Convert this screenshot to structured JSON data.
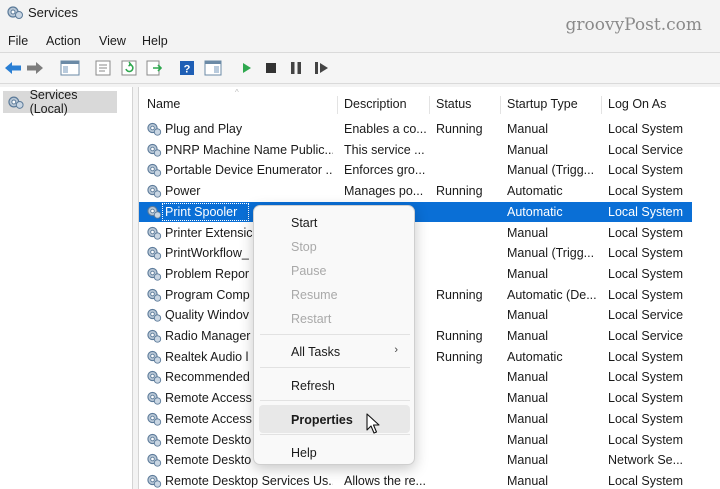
{
  "window": {
    "title": "Services",
    "watermark": "groovyPost.com"
  },
  "menu": [
    "File",
    "Action",
    "View",
    "Help"
  ],
  "toolbar": {
    "icons": [
      "back-arrow-icon",
      "forward-arrow-icon",
      "console-tree-icon",
      "properties-icon",
      "refresh-icon",
      "export-icon",
      "help-icon",
      "view-icon",
      "play-icon",
      "stop-icon",
      "pause-icon",
      "resume-icon"
    ]
  },
  "tree": {
    "label": "Services (Local)"
  },
  "columns": [
    "Name",
    "Description",
    "Status",
    "Startup Type",
    "Log On As"
  ],
  "rows": [
    {
      "name": "Plug and Play",
      "desc": "Enables a co...",
      "status": "Running",
      "startup": "Manual",
      "logon": "Local System"
    },
    {
      "name": "PNRP Machine Name Public...",
      "desc": "This service ...",
      "status": "",
      "startup": "Manual",
      "logon": "Local Service"
    },
    {
      "name": "Portable Device Enumerator ...",
      "desc": "Enforces gro...",
      "status": "",
      "startup": "Manual (Trigg...",
      "logon": "Local System"
    },
    {
      "name": "Power",
      "desc": "Manages po...",
      "status": "Running",
      "startup": "Automatic",
      "logon": "Local System"
    },
    {
      "name": "Print Spooler",
      "desc": "",
      "status": "",
      "startup": "Automatic",
      "logon": "Local System",
      "selected": true
    },
    {
      "name": "Printer Extensic",
      "desc": "",
      "status": "",
      "startup": "Manual",
      "logon": "Local System"
    },
    {
      "name": "PrintWorkflow_",
      "desc": "",
      "status": "",
      "startup": "Manual (Trigg...",
      "logon": "Local System"
    },
    {
      "name": "Problem Repor",
      "desc": "",
      "status": "",
      "startup": "Manual",
      "logon": "Local System"
    },
    {
      "name": "Program Comp",
      "desc": "",
      "status": "Running",
      "startup": "Automatic (De...",
      "logon": "Local System"
    },
    {
      "name": "Quality Windov",
      "desc": "",
      "status": "",
      "startup": "Manual",
      "logon": "Local Service"
    },
    {
      "name": "Radio Manager",
      "desc": "",
      "status": "Running",
      "startup": "Manual",
      "logon": "Local Service"
    },
    {
      "name": "Realtek Audio l",
      "desc": "",
      "status": "Running",
      "startup": "Automatic",
      "logon": "Local System"
    },
    {
      "name": "Recommended",
      "desc": "",
      "status": "",
      "startup": "Manual",
      "logon": "Local System"
    },
    {
      "name": "Remote Access",
      "desc": "",
      "status": "",
      "startup": "Manual",
      "logon": "Local System"
    },
    {
      "name": "Remote Access",
      "desc": "",
      "status": "",
      "startup": "Manual",
      "logon": "Local System"
    },
    {
      "name": "Remote Deskto",
      "desc": "",
      "status": "",
      "startup": "Manual",
      "logon": "Local System"
    },
    {
      "name": "Remote Deskto",
      "desc": "",
      "status": "",
      "startup": "Manual",
      "logon": "Network Se..."
    },
    {
      "name": "Remote Desktop Services Us...",
      "desc": "Allows the re...",
      "status": "",
      "startup": "Manual",
      "logon": "Local System"
    }
  ],
  "context_menu": {
    "start": "Start",
    "stop": "Stop",
    "pause": "Pause",
    "resume": "Resume",
    "restart": "Restart",
    "all_tasks": "All Tasks",
    "refresh": "Refresh",
    "properties": "Properties",
    "help": "Help",
    "disabled": [
      "stop",
      "pause",
      "resume",
      "restart"
    ],
    "highlighted": "properties"
  },
  "colors": {
    "selection": "#0a6fd6",
    "play": "#2fa84f"
  }
}
